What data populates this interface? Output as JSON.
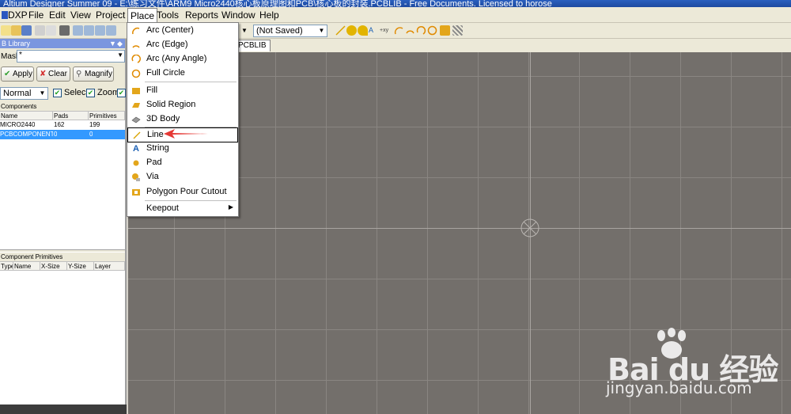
{
  "title": "Altium Designer Summer 09 - E:\\练习文件\\ARM9 Micro2440核心板原理图和PCB\\核心板的封装.PCBLIB - Free Documents. Licensed to horose",
  "menubar": [
    "DXP",
    "File",
    "Edit",
    "View",
    "Project",
    "Place",
    "Tools",
    "Reports",
    "Window",
    "Help"
  ],
  "toolbar": {
    "view_combo": "(Not Saved)"
  },
  "doc_tab": "PCBLIB",
  "panel": {
    "title": "B Library",
    "mask_label": "Mask",
    "mask_value": "*",
    "buttons": {
      "apply": "Apply",
      "clear": "Clear",
      "magnify": "Magnify"
    },
    "mode": "Normal",
    "select_label": "Selec",
    "zoom_label": "Zoom",
    "components_title": "Components",
    "components_columns": [
      "Name",
      "Pads",
      "Primitives"
    ],
    "components_rows": [
      {
        "name": "MICRO2440",
        "pads": "162",
        "primitives": "199"
      },
      {
        "name": "PCBCOMPONENT",
        "pads": "0",
        "primitives": "0"
      }
    ],
    "primitives_title": "Component Primitives",
    "primitives_columns": [
      "Type",
      "Name",
      "X-Size",
      "Y-Size",
      "Layer"
    ]
  },
  "place_menu": {
    "items": [
      {
        "label": "Arc (Center)",
        "icon": "arc-center-icon"
      },
      {
        "label": "Arc (Edge)",
        "icon": "arc-edge-icon"
      },
      {
        "label": "Arc (Any Angle)",
        "icon": "arc-any-angle-icon"
      },
      {
        "label": "Full Circle",
        "icon": "full-circle-icon"
      },
      {
        "label": "Fill",
        "icon": "fill-icon"
      },
      {
        "label": "Solid Region",
        "icon": "solid-region-icon"
      },
      {
        "label": "3D Body",
        "icon": "3d-body-icon"
      },
      {
        "label": "Line",
        "icon": "line-icon"
      },
      {
        "label": "String",
        "icon": "string-icon"
      },
      {
        "label": "Pad",
        "icon": "pad-icon"
      },
      {
        "label": "Via",
        "icon": "via-icon"
      },
      {
        "label": "Polygon Pour Cutout",
        "icon": "polygon-cutout-icon"
      },
      {
        "label": "Keepout",
        "icon": ""
      }
    ]
  },
  "watermark": {
    "main": "Bai du 经验",
    "sub": "jingyan.baidu.com"
  },
  "colors": {
    "workspace": "#736f6b",
    "selection": "#3399ff",
    "accent_arrow": "#e53935",
    "titlebar": "#2a5fbf"
  }
}
